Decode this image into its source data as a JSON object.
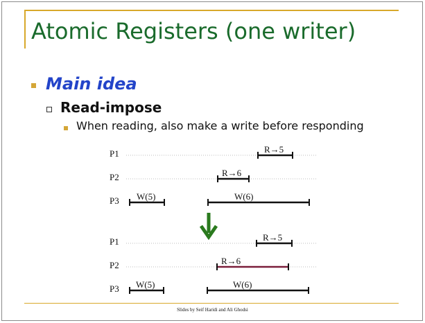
{
  "title": "Atomic Registers (one writer)",
  "bullets": {
    "main": "Main idea",
    "sub": "Read-impose",
    "subsub": "When reading, also make a write before responding"
  },
  "diagram_top": {
    "processes": [
      "P1",
      "P2",
      "P3"
    ],
    "ops": [
      "R→5",
      "R→6",
      "W(5)",
      "W(6)"
    ]
  },
  "diagram_bottom": {
    "processes": [
      "P1",
      "P2",
      "P3"
    ],
    "ops": [
      "R→5",
      "R→6",
      "W(5)",
      "W(6)"
    ]
  },
  "footer": "Slides by Seif Haridi and Ali  Ghodsi",
  "colors": {
    "title": "#1a6b2c",
    "main_idea": "#2344c9",
    "bullet": "#d4a637",
    "arrow": "#2a7a1e",
    "write_back": "#7a1e3a",
    "rule": "#d8a82a"
  }
}
